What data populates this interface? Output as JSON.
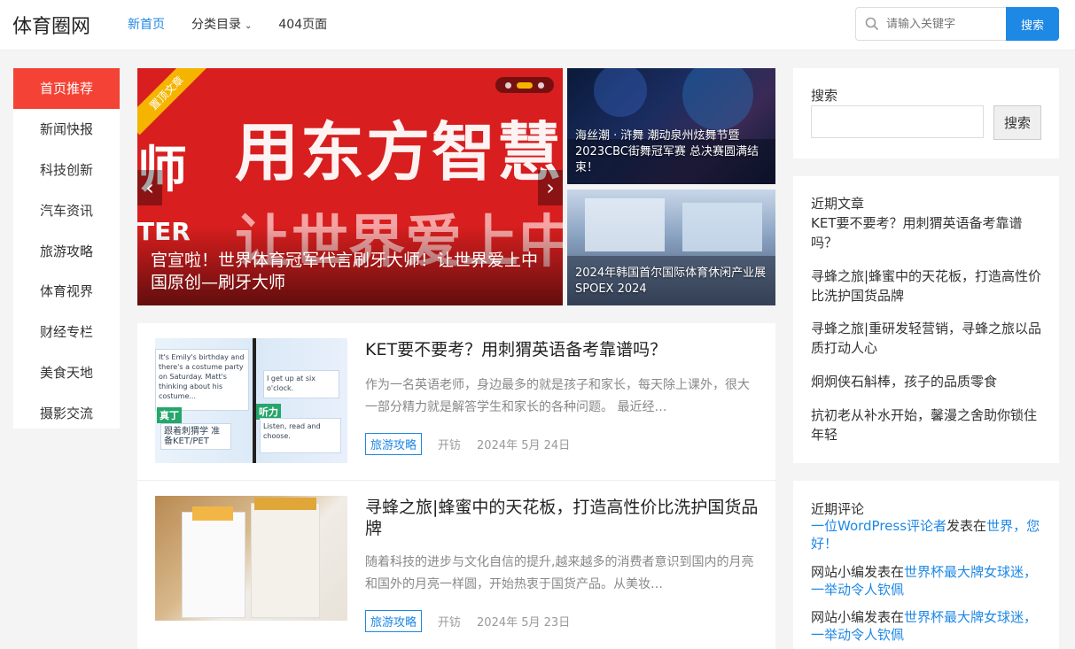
{
  "header": {
    "logo": "体育圈网",
    "nav": [
      {
        "label": "新首页"
      },
      {
        "label": "分类目录"
      },
      {
        "label": "404页面"
      }
    ],
    "search_placeholder": "请输入关键字",
    "search_button": "搜索"
  },
  "left_menu": [
    "首页推荐",
    "新闻快报",
    "科技创新",
    "汽车资讯",
    "旅游攻略",
    "体育视界",
    "财经专栏",
    "美食天地",
    "摄影交流"
  ],
  "banner": {
    "ribbon": "置顶文章",
    "image_text_1": "用东方智慧刷",
    "image_text_2": "让世界爱上中",
    "image_text_0": "师",
    "image_text_3": "TER",
    "caption": "官宣啦！世界体育冠军代言刷牙大师！让世界爱上中国原创—刷牙大师"
  },
  "side_pics": [
    {
      "caption": "海丝潮 · 浒舞 潮动泉州炫舞节暨2023CBC街舞冠军赛 总决赛圆满结束！"
    },
    {
      "caption": "2024年韩国首尔国际体育休闲产业展 SPOEX 2024"
    }
  ],
  "posts": [
    {
      "title": "KET要不要考？用刺猬英语备考靠谱吗？",
      "excerpt": "作为一名英语老师，身边最多的就是孩子和家长，每天除上课外，很大一部分精力就是解答学生和家长的各种问题。 最近经…",
      "tag": "旅游攻略",
      "author": "开钫",
      "date": "2024年 5月 24日",
      "thumb_text": {
        "t1": "It's Emily's birthday and there's a costume party on Saturday. Matt's thinking about his costume...",
        "t2": "I get up at six o'clock.",
        "g1": "真丁",
        "g2": "听力",
        "t3": "Listen, read and choose.",
        "t4": "跟着刺猬学 准备KET/PET"
      }
    },
    {
      "title": "寻蜂之旅|蜂蜜中的天花板，打造高性价比洗护国货品牌",
      "excerpt": "随着科技的进步与文化自信的提升,越来越多的消费者意识到国内的月亮和国外的月亮一样圆，开始热衷于国货产品。从美妆…",
      "tag": "旅游攻略",
      "author": "开钫",
      "date": "2024年 5月 23日"
    }
  ],
  "sidebar": {
    "search_title": "搜索",
    "search_button": "搜索",
    "recent_title": "近期文章",
    "recent": [
      "KET要不要考？用刺猬英语备考靠谱吗？",
      "寻蜂之旅|蜂蜜中的天花板，打造高性价比洗护国货品牌",
      "寻蜂之旅|重研发轻营销，寻蜂之旅以品质打动人心",
      "炯炯侠石斛棒，孩子的品质零食",
      "抗初老从补水开始，馨漫之舍助你锁住年轻"
    ],
    "comments_title": "近期评论",
    "comments": [
      {
        "author": "一位WordPress评论者",
        "mid": "发表在",
        "post": "世界，您好！"
      },
      {
        "author": "网站小编",
        "mid": "发表在",
        "post": "世界杯最大牌女球迷，一举动令人钦佩"
      },
      {
        "author": "网站小编",
        "mid": "发表在",
        "post": "世界杯最大牌女球迷，一举动令人钦佩"
      }
    ]
  },
  "colors": {
    "accent": "#1e88e5",
    "active_menu": "#f44336",
    "ribbon": "#f5b400"
  }
}
